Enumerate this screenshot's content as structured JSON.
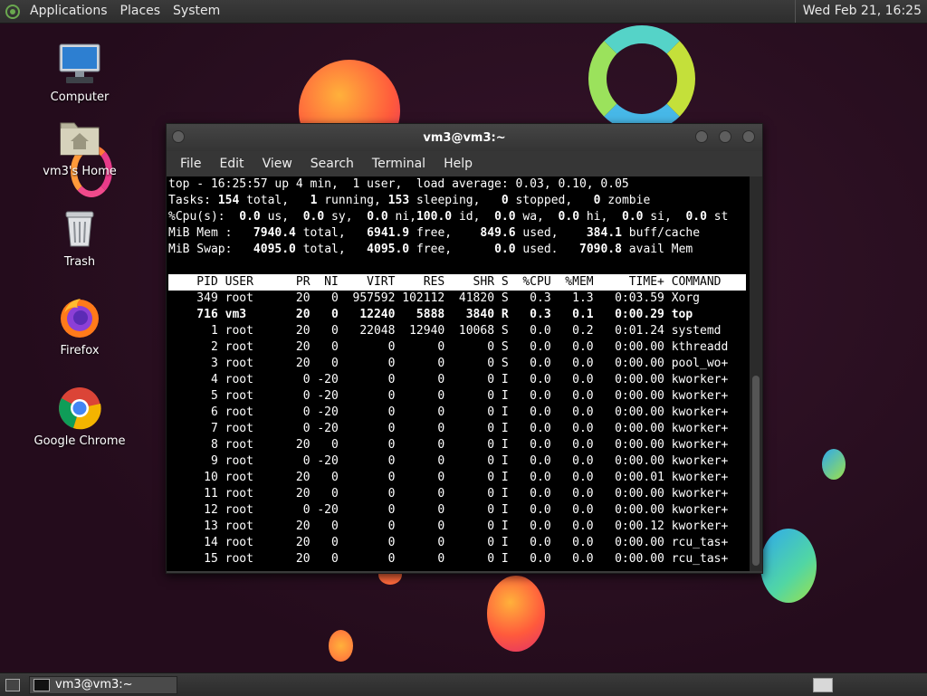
{
  "top_panel": {
    "menus": [
      "Applications",
      "Places",
      "System"
    ],
    "clock": "Wed Feb 21, 16:25"
  },
  "desktop": {
    "icons": [
      {
        "label": "Computer",
        "icon": "computer-icon"
      },
      {
        "label": "vm3's Home",
        "icon": "home-folder-icon"
      },
      {
        "label": "Trash",
        "icon": "trash-icon"
      },
      {
        "label": "Firefox",
        "icon": "firefox-icon"
      },
      {
        "label": "Google Chrome",
        "icon": "chrome-icon"
      }
    ]
  },
  "terminal": {
    "title": "vm3@vm3:~",
    "menus": [
      "File",
      "Edit",
      "View",
      "Search",
      "Terminal",
      "Help"
    ],
    "summary": {
      "line1": "top - 16:25:57 up 4 min,  1 user,  load average: 0.03, 0.10, 0.05",
      "tasks": [
        "Tasks: ",
        "154",
        " total,   ",
        "1",
        " running, ",
        "153",
        " sleeping,   ",
        "0",
        " stopped,   ",
        "0",
        " zombie"
      ],
      "cpu": [
        "%Cpu(s):  ",
        "0.0",
        " us,  ",
        "0.0",
        " sy,  ",
        "0.0",
        " ni,",
        "100.0",
        " id,  ",
        "0.0",
        " wa,  ",
        "0.0",
        " hi,  ",
        "0.0",
        " si,  ",
        "0.0",
        " st"
      ],
      "mem": [
        "MiB Mem :   ",
        "7940.4",
        " total,   ",
        "6941.9",
        " free,    ",
        "849.6",
        " used,    ",
        "384.1",
        " buff/cache"
      ],
      "swap": [
        "MiB Swap:   ",
        "4095.0",
        " total,   ",
        "4095.0",
        " free,      ",
        "0.0",
        " used.   ",
        "7090.8",
        " avail Mem"
      ]
    },
    "header": "    PID USER      PR  NI    VIRT    RES    SHR S  %CPU  %MEM     TIME+ COMMAND",
    "processes": [
      {
        "text": "    349 root      20   0  957592 102112  41820 S   0.3   1.3   0:03.59 Xorg",
        "bold": false
      },
      {
        "text": "    716 vm3       20   0   12240   5888   3840 R   0.3   0.1   0:00.29 top",
        "bold": true
      },
      {
        "text": "      1 root      20   0   22048  12940  10068 S   0.0   0.2   0:01.24 systemd",
        "bold": false
      },
      {
        "text": "      2 root      20   0       0      0      0 S   0.0   0.0   0:00.00 kthreadd",
        "bold": false
      },
      {
        "text": "      3 root      20   0       0      0      0 S   0.0   0.0   0:00.00 pool_wo+",
        "bold": false
      },
      {
        "text": "      4 root       0 -20       0      0      0 I   0.0   0.0   0:00.00 kworker+",
        "bold": false
      },
      {
        "text": "      5 root       0 -20       0      0      0 I   0.0   0.0   0:00.00 kworker+",
        "bold": false
      },
      {
        "text": "      6 root       0 -20       0      0      0 I   0.0   0.0   0:00.00 kworker+",
        "bold": false
      },
      {
        "text": "      7 root       0 -20       0      0      0 I   0.0   0.0   0:00.00 kworker+",
        "bold": false
      },
      {
        "text": "      8 root      20   0       0      0      0 I   0.0   0.0   0:00.00 kworker+",
        "bold": false
      },
      {
        "text": "      9 root       0 -20       0      0      0 I   0.0   0.0   0:00.00 kworker+",
        "bold": false
      },
      {
        "text": "     10 root      20   0       0      0      0 I   0.0   0.0   0:00.01 kworker+",
        "bold": false
      },
      {
        "text": "     11 root      20   0       0      0      0 I   0.0   0.0   0:00.00 kworker+",
        "bold": false
      },
      {
        "text": "     12 root       0 -20       0      0      0 I   0.0   0.0   0:00.00 kworker+",
        "bold": false
      },
      {
        "text": "     13 root      20   0       0      0      0 I   0.0   0.0   0:00.12 kworker+",
        "bold": false
      },
      {
        "text": "     14 root      20   0       0      0      0 I   0.0   0.0   0:00.00 rcu_tas+",
        "bold": false
      },
      {
        "text": "     15 root      20   0       0      0      0 I   0.0   0.0   0:00.00 rcu_tas+",
        "bold": false
      }
    ]
  },
  "bottom_panel": {
    "task_label": "vm3@vm3:~"
  },
  "colors": {
    "wallpaper": "#240c1c",
    "panel": "#333333",
    "terminal_bg": "#000000"
  }
}
